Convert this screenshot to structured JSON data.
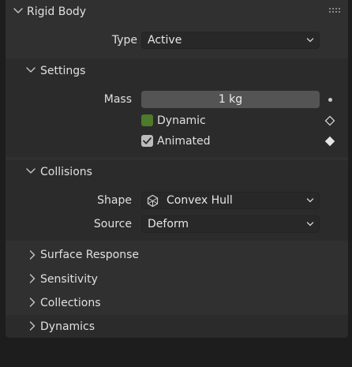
{
  "panel": {
    "title": "Rigid Body",
    "type_label": "Type",
    "type_value": "Active"
  },
  "settings": {
    "title": "Settings",
    "mass_label": "Mass",
    "mass_value": "1 kg",
    "dynamic_label": "Dynamic",
    "dynamic_checked": false,
    "animated_label": "Animated",
    "animated_checked": true
  },
  "collisions": {
    "title": "Collisions",
    "shape_label": "Shape",
    "shape_value": "Convex Hull",
    "source_label": "Source",
    "source_value": "Deform"
  },
  "subpanels": [
    "Surface Response",
    "Sensitivity",
    "Collections"
  ],
  "dynamics": {
    "title": "Dynamics"
  },
  "colors": {
    "accent_green": "#4e7a2b",
    "checked_box": "#bdbdbd"
  }
}
